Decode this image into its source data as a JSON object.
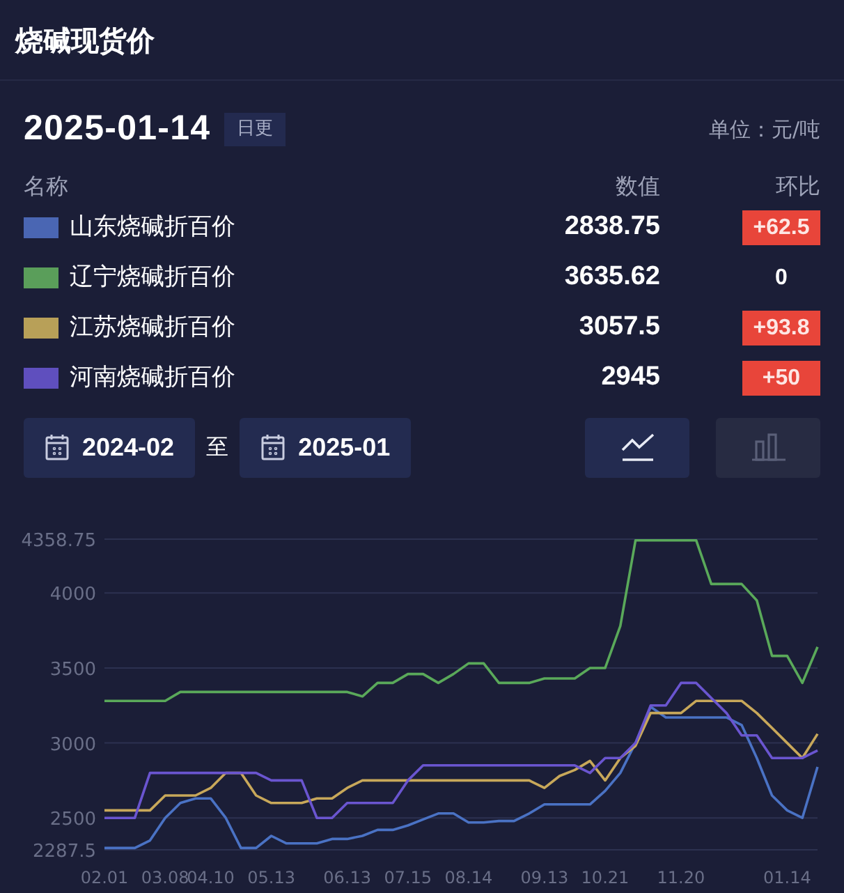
{
  "title": "烧碱现货价",
  "date": "2025-01-14",
  "update_badge": "日更",
  "unit": "单位：元/吨",
  "columns": [
    "名称",
    "数值",
    "环比"
  ],
  "rows": [
    {
      "name": "山东烧碱折百价",
      "value": "2838.75",
      "change": "+62.5",
      "highlight": true,
      "color": "#4a66b3"
    },
    {
      "name": "辽宁烧碱折百价",
      "value": "3635.62",
      "change": "0",
      "highlight": false,
      "color": "#5a9e5a"
    },
    {
      "name": "江苏烧碱折百价",
      "value": "3057.5",
      "change": "+93.8",
      "highlight": true,
      "color": "#b8a058"
    },
    {
      "name": "河南烧碱折百价",
      "value": "2945",
      "change": "+50",
      "highlight": true,
      "color": "#5f4fbe"
    }
  ],
  "range": {
    "start": "2024-02",
    "separator": "至",
    "end": "2025-01"
  },
  "chart_types": [
    {
      "kind": "line",
      "selected": true
    },
    {
      "kind": "bar",
      "selected": false
    }
  ],
  "chart_data": {
    "type": "line",
    "categories": [
      "02.01",
      null,
      null,
      null,
      "03.08",
      null,
      null,
      "04.10",
      null,
      null,
      null,
      "05.13",
      null,
      null,
      null,
      null,
      "06.13",
      null,
      null,
      null,
      "07.15",
      null,
      null,
      null,
      "08.14",
      null,
      null,
      null,
      null,
      "09.13",
      null,
      null,
      null,
      "10.21",
      null,
      null,
      null,
      null,
      "11.20",
      null,
      null,
      null,
      null,
      null,
      null,
      "01.14",
      null,
      null
    ],
    "ylim": [
      2287.5,
      4358.75
    ],
    "grid": true,
    "yticks": [
      2287.5,
      2500,
      3000,
      3500,
      4000,
      4358.75
    ],
    "series": [
      {
        "color": "#5aa95a",
        "values": [
          3280,
          3280,
          3280,
          3280,
          3280,
          3340,
          3340,
          3340,
          3340,
          3340,
          3340,
          3340,
          3340,
          3340,
          3340,
          3340,
          3340,
          3310,
          3400,
          3400,
          3460,
          3460,
          3400,
          3460,
          3530,
          3530,
          3400,
          3400,
          3400,
          3430,
          3430,
          3430,
          3500,
          3500,
          3780,
          4350,
          4350,
          4350,
          4350,
          4350,
          4060,
          4060,
          4060,
          3950,
          3580,
          3580,
          3400,
          3640
        ]
      },
      {
        "color": "#4a72c4",
        "values": [
          2300,
          2300,
          2300,
          2350,
          2500,
          2600,
          2630,
          2630,
          2500,
          2300,
          2300,
          2380,
          2330,
          2330,
          2330,
          2360,
          2360,
          2380,
          2420,
          2420,
          2450,
          2490,
          2530,
          2530,
          2470,
          2470,
          2480,
          2480,
          2530,
          2590,
          2590,
          2590,
          2590,
          2680,
          2800,
          3000,
          3240,
          3170,
          3170,
          3170,
          3170,
          3170,
          3120,
          2900,
          2650,
          2550,
          2500,
          2840
        ]
      },
      {
        "color": "#c8a85a",
        "values": [
          2550,
          2550,
          2550,
          2550,
          2650,
          2650,
          2650,
          2700,
          2800,
          2800,
          2650,
          2600,
          2600,
          2600,
          2630,
          2630,
          2700,
          2750,
          2750,
          2750,
          2750,
          2750,
          2750,
          2750,
          2750,
          2750,
          2750,
          2750,
          2750,
          2700,
          2780,
          2820,
          2880,
          2750,
          2900,
          2980,
          3200,
          3200,
          3200,
          3280,
          3280,
          3280,
          3280,
          3200,
          3100,
          3000,
          2900,
          3060
        ]
      },
      {
        "color": "#6a55d0",
        "values": [
          2500,
          2500,
          2500,
          2800,
          2800,
          2800,
          2800,
          2800,
          2800,
          2800,
          2800,
          2750,
          2750,
          2750,
          2500,
          2500,
          2600,
          2600,
          2600,
          2600,
          2750,
          2850,
          2850,
          2850,
          2850,
          2850,
          2850,
          2850,
          2850,
          2850,
          2850,
          2850,
          2800,
          2900,
          2900,
          3000,
          3250,
          3250,
          3400,
          3400,
          3300,
          3200,
          3050,
          3050,
          2900,
          2900,
          2900,
          2950
        ]
      }
    ]
  }
}
